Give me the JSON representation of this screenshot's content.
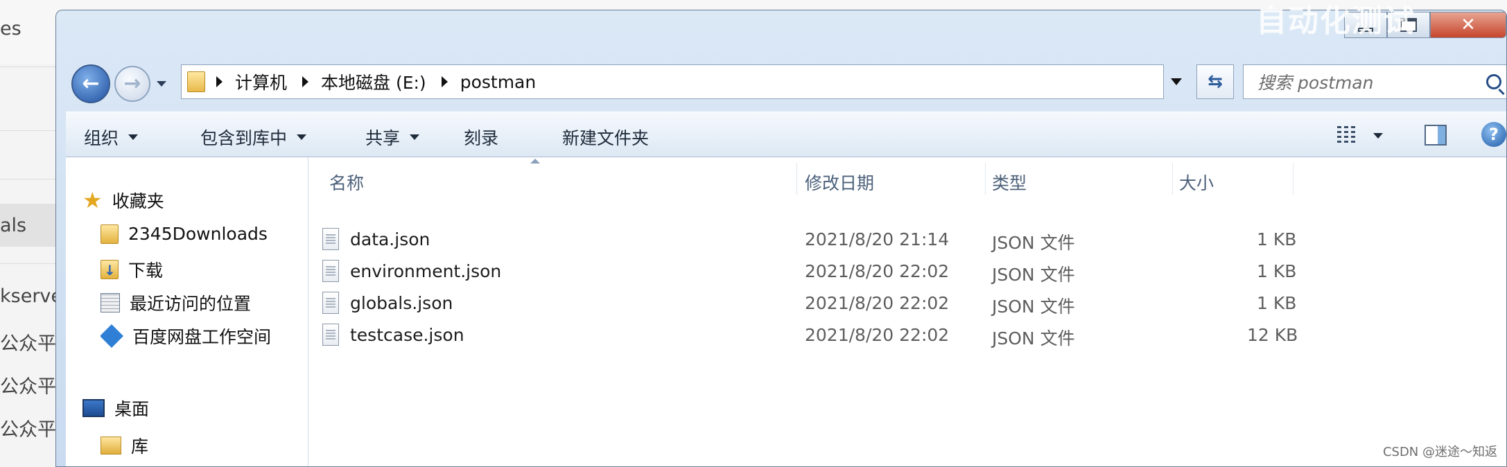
{
  "window_title_overlay": "自动化测试",
  "background_app": {
    "sidebar_items": [
      "es",
      "als",
      "kserve",
      "公众平",
      "公众平",
      "公众平"
    ]
  },
  "nav": {
    "back_glyph": "←",
    "forward_glyph": "→"
  },
  "address": {
    "crumbs": [
      "计算机",
      "本地磁盘 (E:)",
      "postman"
    ],
    "refresh_glyph": "⇆"
  },
  "search": {
    "placeholder": "搜索 postman"
  },
  "toolbar": {
    "organize": "组织",
    "include_in_library": "包含到库中",
    "share": "共享",
    "burn": "刻录",
    "new_folder": "新建文件夹",
    "help_glyph": "?"
  },
  "navpane": {
    "favorites": "收藏夹",
    "items": [
      "2345Downloads",
      "下载",
      "最近访问的位置",
      "百度网盘工作空间"
    ],
    "desktop": "桌面",
    "library": "库"
  },
  "columns": {
    "name": "名称",
    "modified": "修改日期",
    "type": "类型",
    "size": "大小"
  },
  "files": [
    {
      "name": "data.json",
      "modified": "2021/8/20 21:14",
      "type": "JSON 文件",
      "size": "1 KB"
    },
    {
      "name": "environment.json",
      "modified": "2021/8/20 22:02",
      "type": "JSON 文件",
      "size": "1 KB"
    },
    {
      "name": "globals.json",
      "modified": "2021/8/20 22:02",
      "type": "JSON 文件",
      "size": "1 KB"
    },
    {
      "name": "testcase.json",
      "modified": "2021/8/20 22:02",
      "type": "JSON 文件",
      "size": "12 KB"
    }
  ],
  "watermark": "CSDN @迷途～知返"
}
